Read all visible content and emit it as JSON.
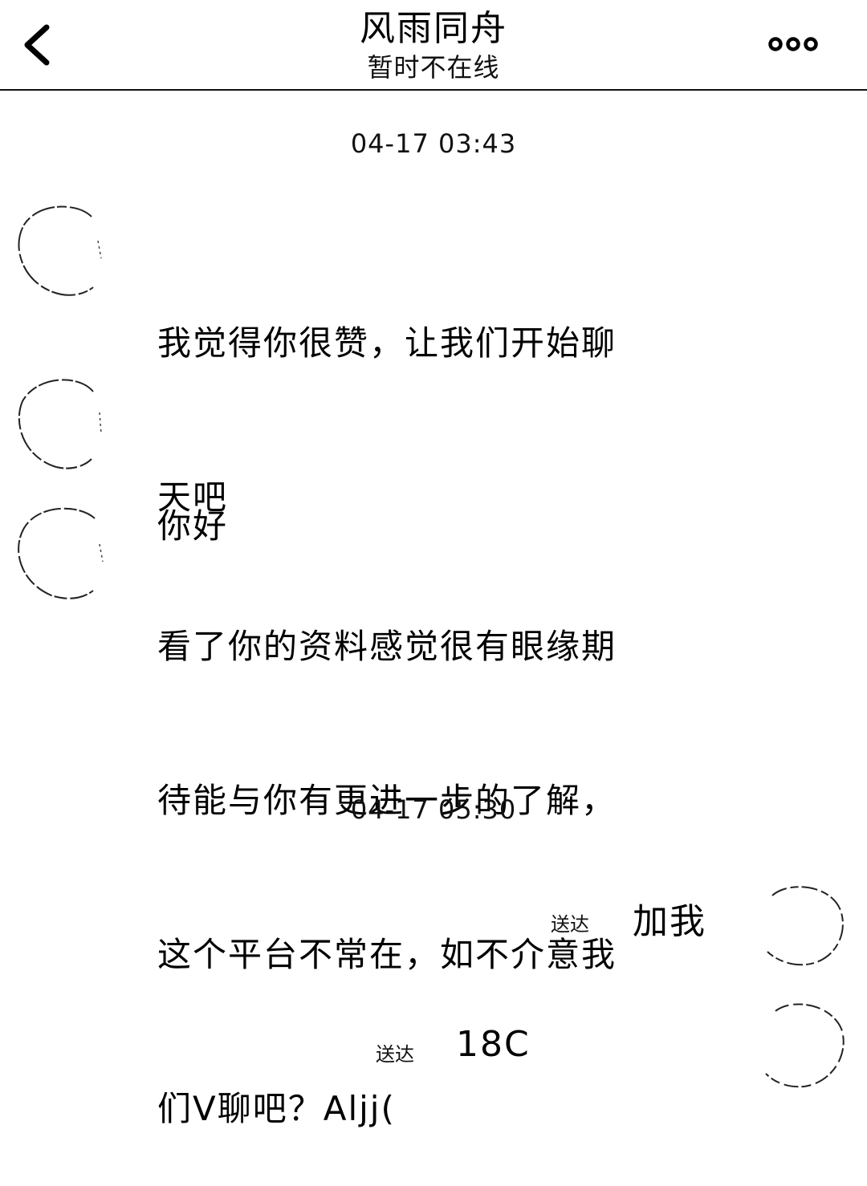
{
  "header": {
    "title": "风雨同舟",
    "status": "暂时不在线",
    "back_icon": "chevron-left-icon",
    "more_icon": "more-dots-icon"
  },
  "conversation": {
    "timestamps": [
      "04-17 03:43",
      "04-17 05:30"
    ],
    "received": [
      {
        "lines": [
          "我觉得你很赞，让我们开始聊",
          "天吧"
        ]
      },
      {
        "lines": [
          "你好"
        ]
      },
      {
        "lines": [
          "看了你的资料感觉很有眼缘期",
          "待能与你有更进一步的了解，",
          "这个平台不常在，如不介意我",
          "们V聊吧？Aljj("
        ]
      }
    ],
    "sent": [
      {
        "text": "加我",
        "status": "送达"
      },
      {
        "text": "18C",
        "status": "送达"
      }
    ]
  }
}
